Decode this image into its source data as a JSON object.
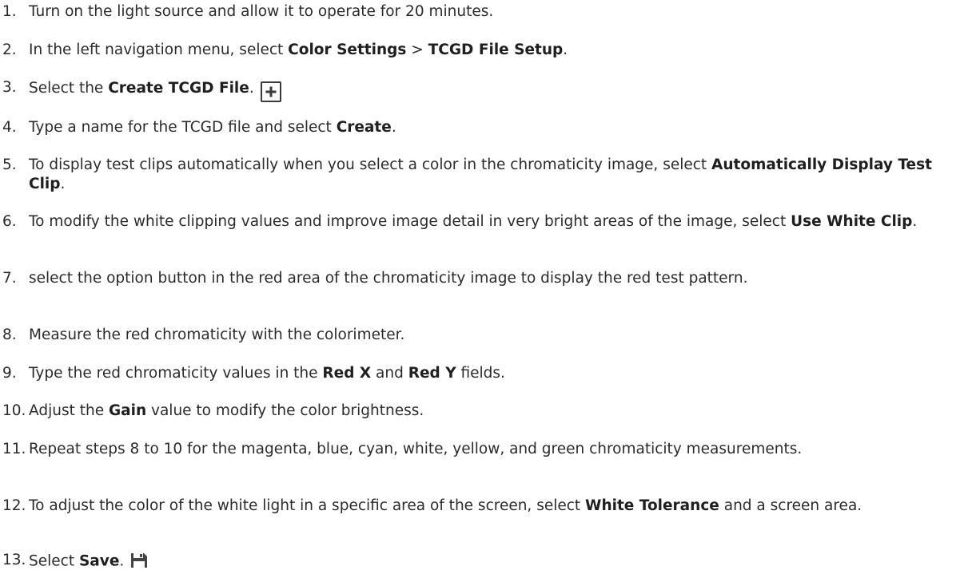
{
  "steps": [
    {
      "number": "1.",
      "parts": [
        "Turn on the light source and allow it to operate for 20 minutes."
      ]
    },
    {
      "number": "2.",
      "parts": [
        "In the left navigation menu, select ",
        "Color Settings",
        " > ",
        "TCGD File Setup",
        "."
      ]
    },
    {
      "number": "3.",
      "parts": [
        "Select the ",
        "Create TCGD File",
        "."
      ],
      "icon": "plus-icon"
    },
    {
      "number": "4.",
      "parts": [
        "Type a name for the TCGD file and select ",
        "Create",
        "."
      ]
    },
    {
      "number": "5.",
      "parts": [
        "To display test clips automatically when you select a color in the chromaticity image, select ",
        "Automatically Display Test Clip",
        "."
      ]
    },
    {
      "number": "6.",
      "parts": [
        "To modify the white clipping values and improve image detail in very bright areas of the image, select ",
        "Use White Clip",
        "."
      ]
    },
    {
      "number": "7.",
      "parts": [
        "select the option button in the red area of the chromaticity image to display the red test pattern."
      ]
    },
    {
      "number": "8.",
      "parts": [
        "Measure the red chromaticity with the colorimeter."
      ]
    },
    {
      "number": "9.",
      "parts": [
        "Type the red chromaticity values in the ",
        "Red X",
        " and ",
        "Red Y",
        " fields."
      ]
    },
    {
      "number": "10.",
      "parts": [
        "Adjust the ",
        "Gain",
        " value to modify the color brightness."
      ]
    },
    {
      "number": "11.",
      "parts": [
        "Repeat steps 8 to 10 for the magenta, blue, cyan, white, yellow, and green chromaticity measurements."
      ]
    },
    {
      "number": "12.",
      "parts": [
        "To adjust the color of the white light in a specific area of the screen, select ",
        "White Tolerance",
        " and a screen area."
      ]
    },
    {
      "number": "13.",
      "parts": [
        "Select ",
        "Save",
        "."
      ],
      "icon": "save-icon"
    }
  ]
}
